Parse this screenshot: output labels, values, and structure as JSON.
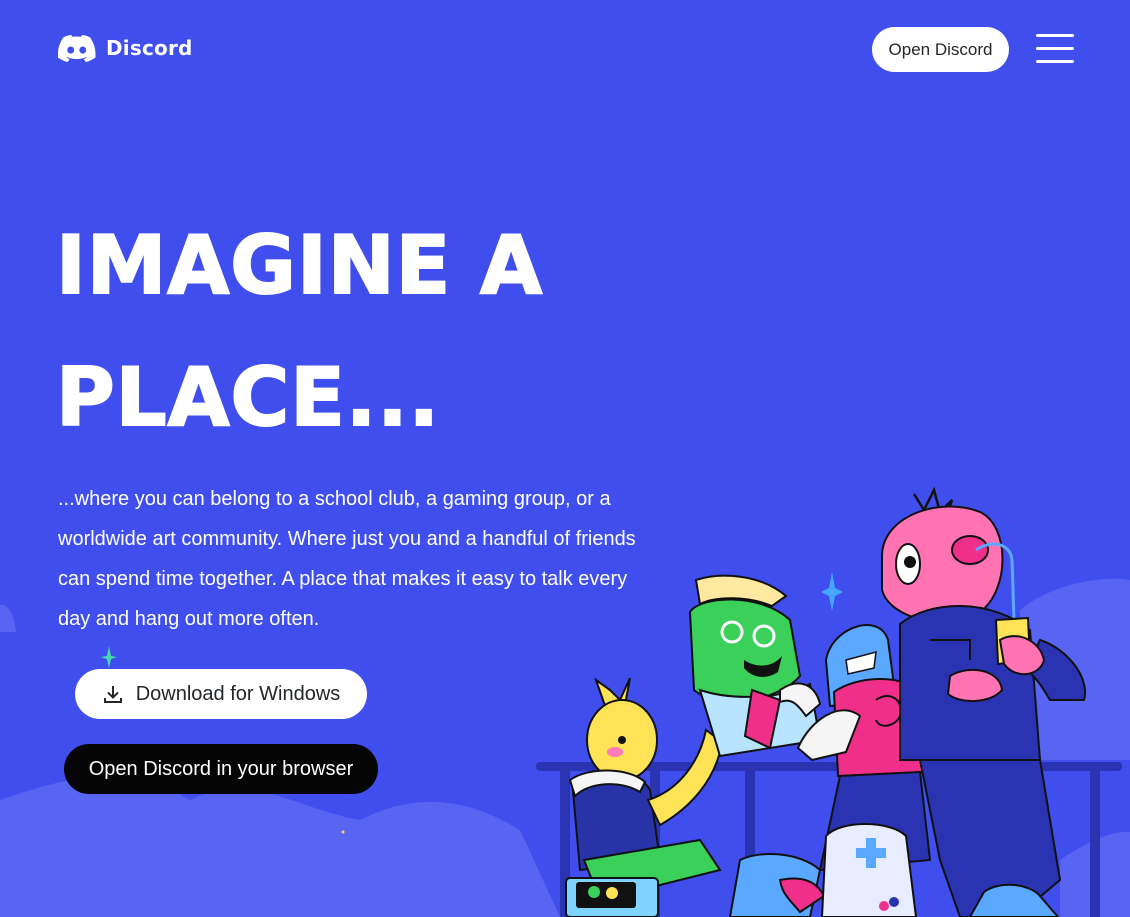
{
  "header": {
    "brand_name": "Discord",
    "open_button_label": "Open Discord",
    "icons": {
      "logo": "discord-logo-icon",
      "menu": "hamburger-menu-icon"
    }
  },
  "hero": {
    "headline_line1": "IMAGINE A",
    "headline_line2": "PLACE...",
    "description": "...where you can belong to a school club, a gaming group, or a worldwide art community. Where just you and a handful of friends can spend time together. A place that makes it easy to talk every day and hang out more often.",
    "download_label": "Download for Windows",
    "browser_label": "Open Discord in your browser",
    "download_icon": "download-icon"
  },
  "colors": {
    "background": "#404eed",
    "hill": "#5865f2",
    "button_light": "#ffffff",
    "button_dark": "#050505",
    "text_dark": "#23272a"
  }
}
